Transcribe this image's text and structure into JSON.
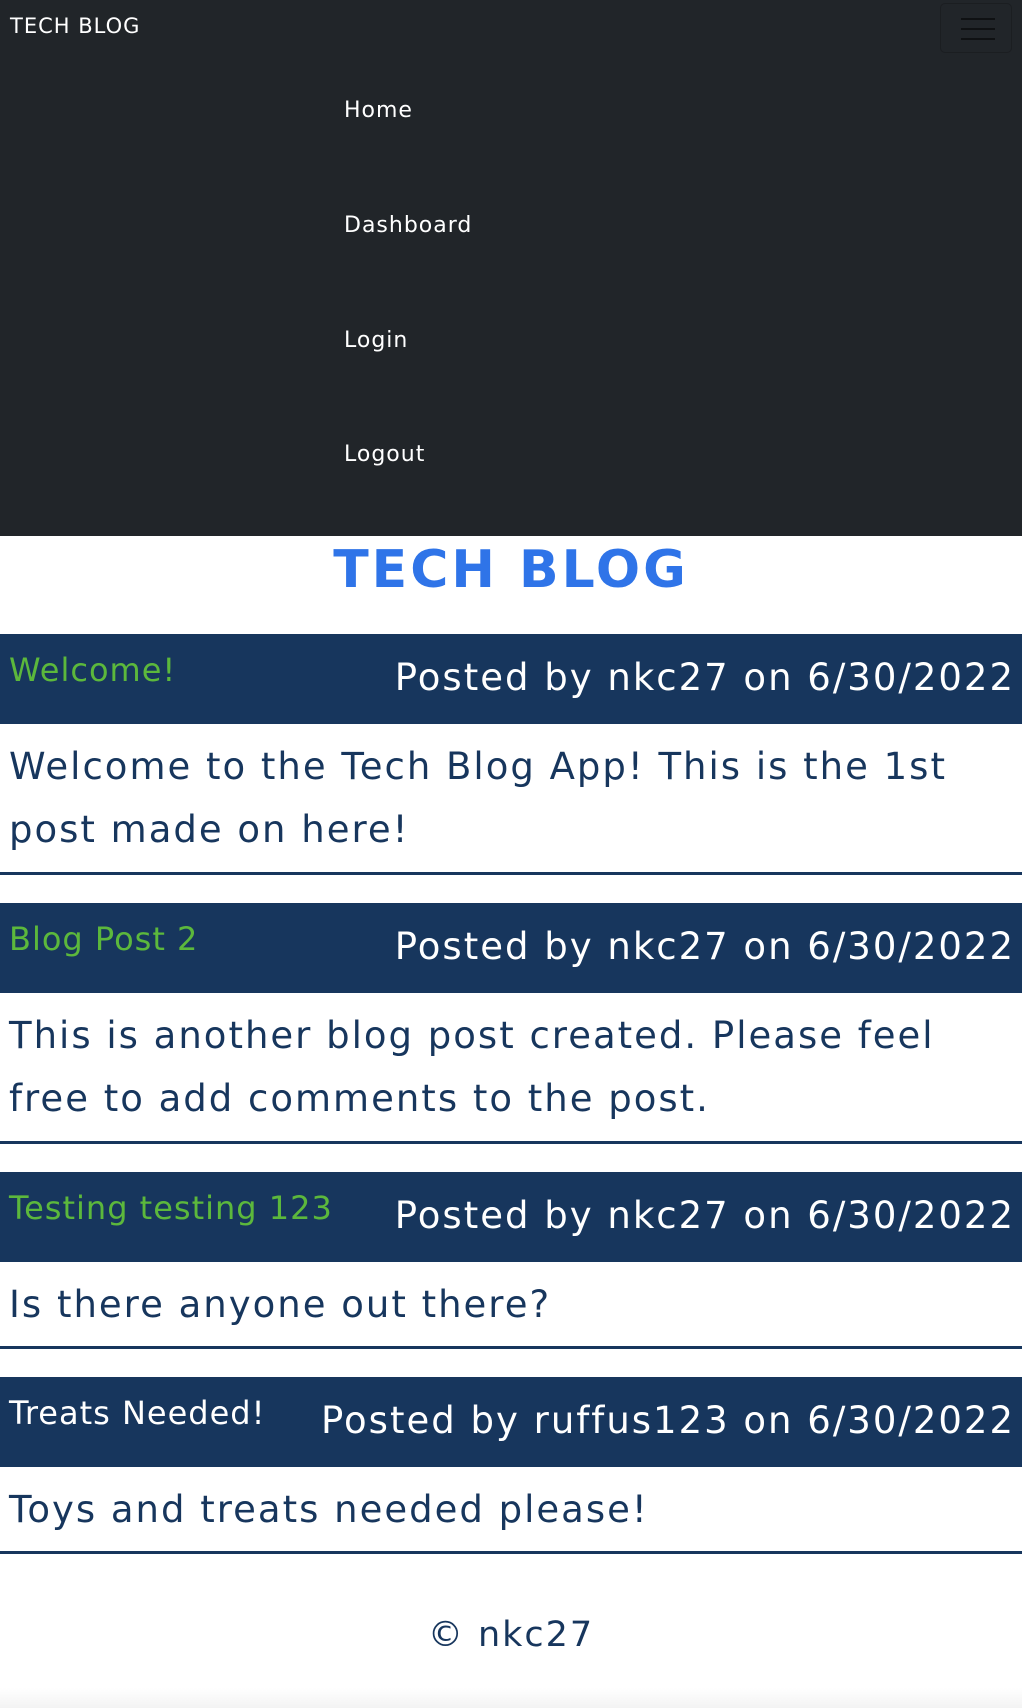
{
  "navbar": {
    "brand": "TECH BLOG",
    "toggler_icon": "hamburger-menu-icon",
    "links": [
      "Home",
      "Dashboard",
      "Login",
      "Logout"
    ]
  },
  "page_title": "TECH BLOG",
  "posts": [
    {
      "title": "Welcome!",
      "meta": "Posted by nkc27 on 6/30/2022",
      "body": "Welcome to the Tech Blog App! This is the 1st post made on here!"
    },
    {
      "title": "Blog Post 2",
      "meta": "Posted by nkc27 on 6/30/2022",
      "body": "This is another blog post created. Please feel free to add comments to the post."
    },
    {
      "title": "Testing testing 123",
      "meta": "Posted by nkc27 on 6/30/2022",
      "body": "Is there anyone out there?"
    },
    {
      "title": "Treats Needed!",
      "meta": "Posted by ruffus123 on 6/30/2022",
      "body": "Toys and treats needed please!"
    }
  ],
  "footer": "© nkc27",
  "colors": {
    "navbar_bg": "#212529",
    "post_header_bg": "#17365d",
    "title_accent": "#2f74e8",
    "post_title_green": "#5cb83c"
  }
}
